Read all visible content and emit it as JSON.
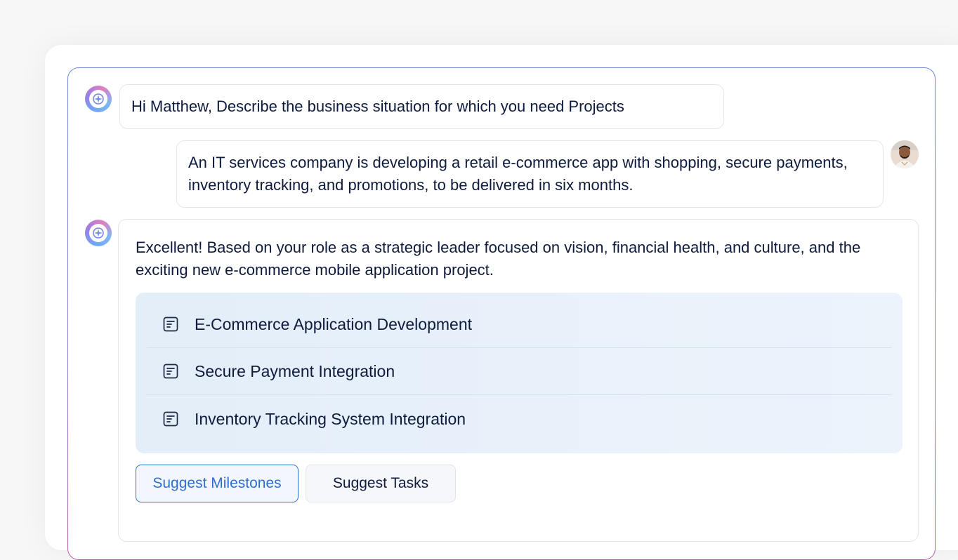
{
  "conversation": {
    "bot_greeting": "Hi Matthew, Describe the business situation for which you need Projects",
    "user_message": "An IT services company is developing a retail e-commerce app with shopping, secure payments, inventory tracking, and promotions, to be delivered in six months.",
    "bot_response": {
      "intro": "Excellent! Based on your role as a strategic leader focused on vision, financial health, and culture, and the exciting new e-commerce mobile application project.",
      "projects": [
        {
          "label": "E-Commerce Application Development",
          "icon": "document-list-icon"
        },
        {
          "label": "Secure Payment Integration",
          "icon": "document-list-icon"
        },
        {
          "label": "Inventory Tracking System Integration",
          "icon": "document-list-icon"
        }
      ],
      "actions": {
        "primary_label": "Suggest Milestones",
        "secondary_label": "Suggest Tasks"
      }
    }
  },
  "colors": {
    "accent": "#2f6fcf",
    "text": "#0f1b3d",
    "list_background": "#e3eef9"
  }
}
